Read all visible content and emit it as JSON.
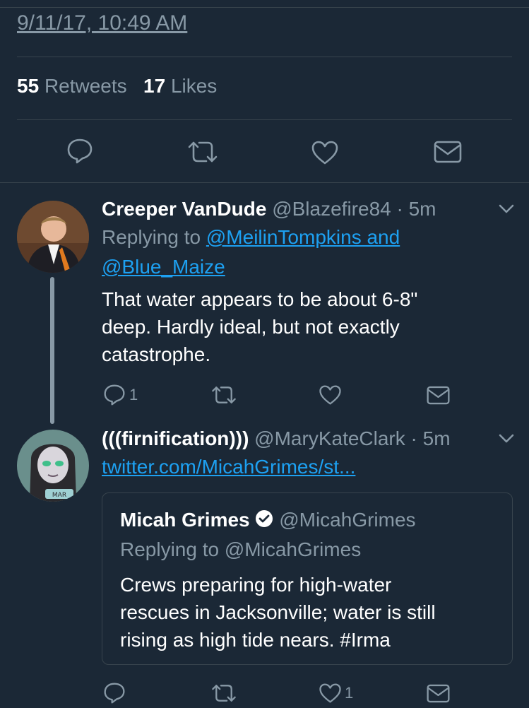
{
  "tweet": {
    "timestamp": "9/11/17, 10:49 AM",
    "retweets_count": "55",
    "retweets_label": "Retweets",
    "likes_count": "17",
    "likes_label": "Likes"
  },
  "replies": [
    {
      "display_name": "Creeper VanDude",
      "handle": "@Blazefire84",
      "time": "· 5m",
      "replying_prefix": "Replying to",
      "replying_line1": "@MeilinTompkins and",
      "replying_line2": "@Blue_Maize",
      "text_line1": "That water appears to be about 6-8\"",
      "text_line2": "deep. Hardly ideal, but not exactly",
      "text_line3": "catastrophe.",
      "reply_count": "1"
    },
    {
      "display_name": "(((firnification)))",
      "handle": "@MaryKateClark",
      "time": "· 5m",
      "link": "twitter.com/MicahGrimes/st...",
      "like_count": "1",
      "quoted": {
        "display_name": "Micah Grimes",
        "handle": "@MicahGrimes",
        "replying": "Replying to @MicahGrimes",
        "text_line1": "Crews preparing for high-water",
        "text_line2": "rescues in Jacksonville; water is still",
        "text_line3": "rising as high tide nears. #Irma"
      }
    }
  ],
  "colors": {
    "background": "#1b2836",
    "muted": "#8899a6",
    "link": "#1da1f2",
    "divider": "#38444d"
  }
}
